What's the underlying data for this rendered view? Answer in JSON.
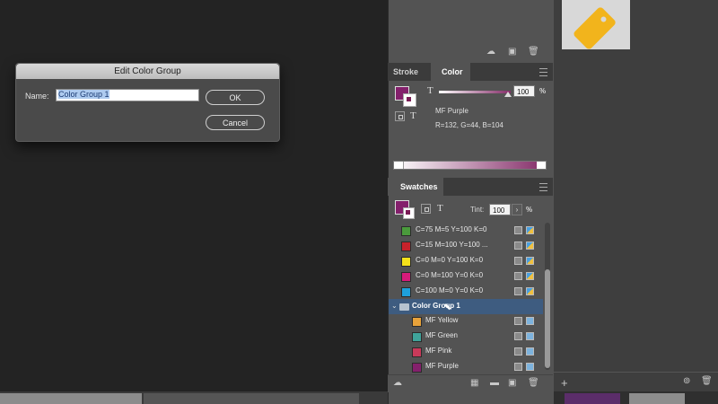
{
  "dialog": {
    "title": "Edit Color Group",
    "name_label": "Name:",
    "name_value": "Color Group 1",
    "ok_label": "OK",
    "cancel_label": "Cancel"
  },
  "color_panel": {
    "tabs": [
      "Stroke",
      "Color"
    ],
    "active_tab": "Color",
    "tint_glyph": "T",
    "tint_value": "100",
    "percent": "%",
    "color_name": "MF Purple",
    "rgb": "R=132, G=44, B=104",
    "fill_color": "#84206c"
  },
  "swatches_panel": {
    "title": "Swatches",
    "tint_label": "Tint:",
    "tint_value": "100",
    "percent": "%",
    "swatches": [
      {
        "name": "C=75 M=5 Y=100 K=0",
        "color": "#4a9a3c"
      },
      {
        "name": "C=15 M=100 Y=100 ...",
        "color": "#c8222b"
      },
      {
        "name": "C=0 M=0 Y=100 K=0",
        "color": "#f6e21a"
      },
      {
        "name": "C=0 M=100 Y=0 K=0",
        "color": "#d81b7a"
      },
      {
        "name": "C=100 M=0 Y=0 K=0",
        "color": "#1ea0dc"
      }
    ],
    "group": {
      "name": "Color Group 1",
      "items": [
        {
          "name": "MF Yellow",
          "color": "#e8a23a"
        },
        {
          "name": "MF Green",
          "color": "#3fa39a"
        },
        {
          "name": "MF Pink",
          "color": "#c93a5a"
        },
        {
          "name": "MF Purple",
          "color": "#84206c"
        }
      ]
    }
  },
  "icons": {
    "panel_menu": "menu-icon",
    "folder": "folder-icon",
    "cursor": "pointer-cursor-icon",
    "tag": "tag-icon"
  }
}
